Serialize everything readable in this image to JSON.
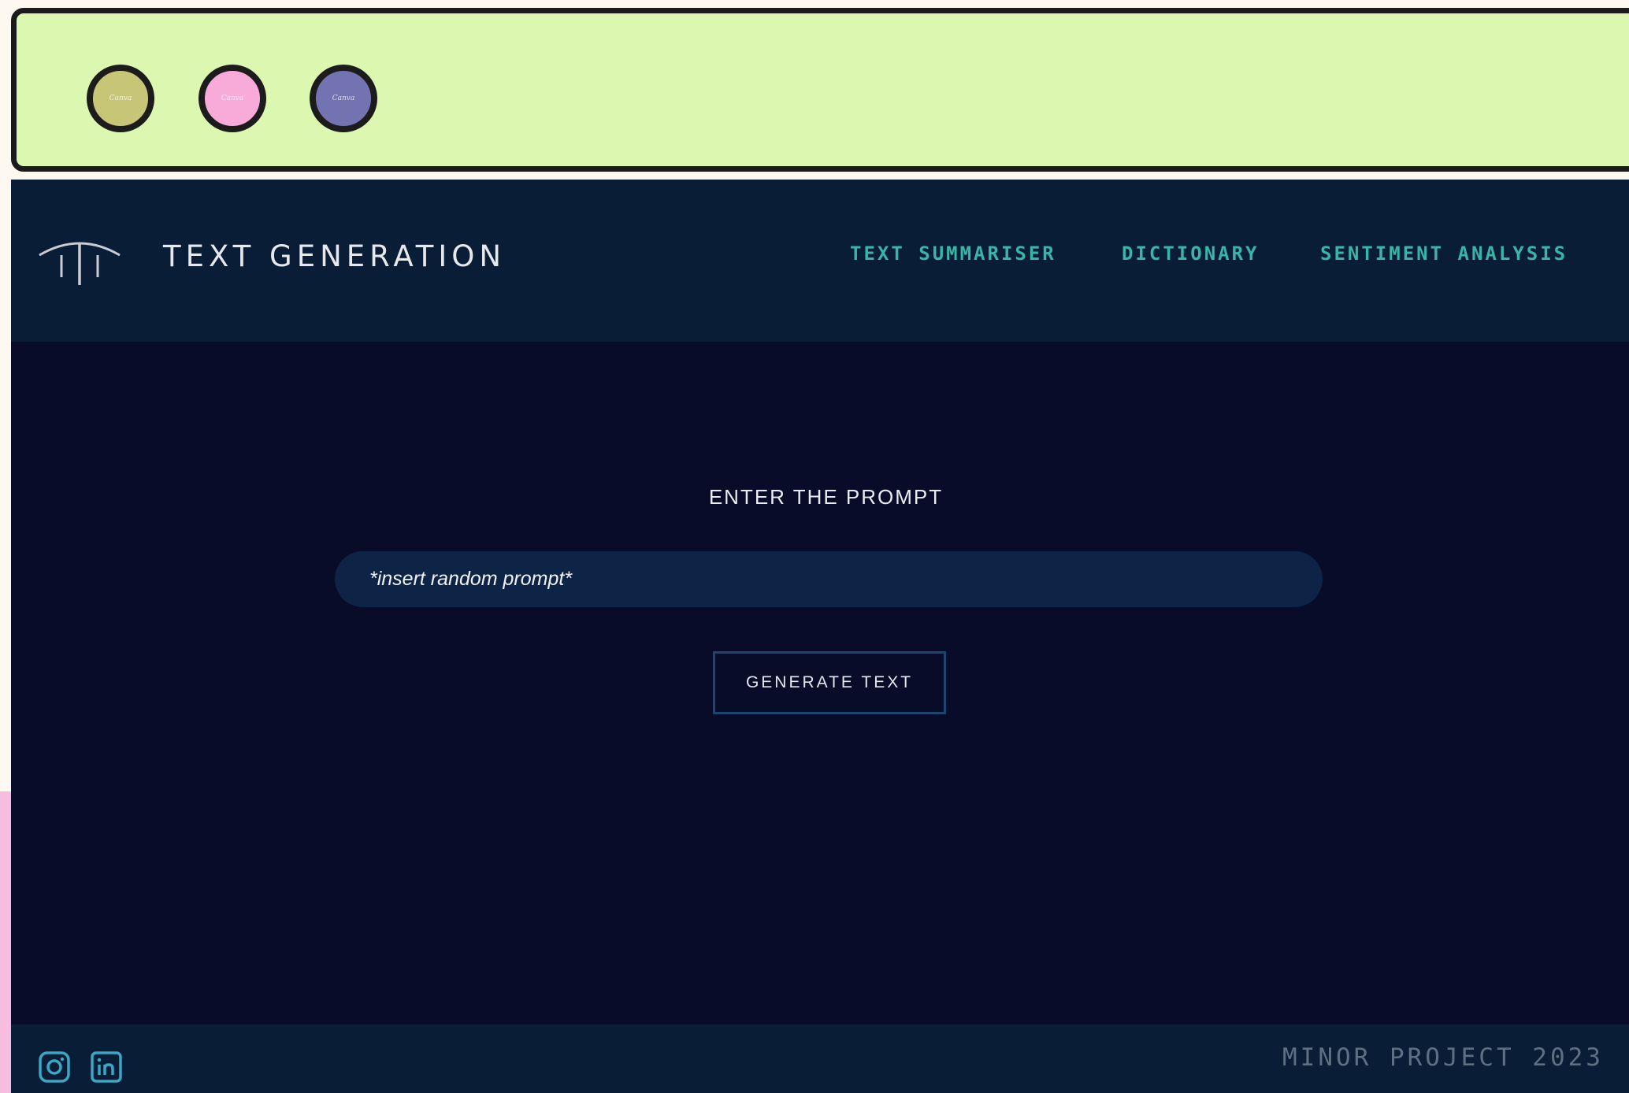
{
  "window": {
    "controls": [
      {
        "name": "dot-olive",
        "color": "#c7c677",
        "label": "Canva"
      },
      {
        "name": "dot-pink",
        "color": "#f8abd9",
        "label": "Canva"
      },
      {
        "name": "dot-purple",
        "color": "#7373b2",
        "label": "Canva"
      }
    ],
    "title_bar_color": "#dcf8b0"
  },
  "header": {
    "logo_icon": "pillars-logo-icon",
    "title": "TEXT GENERATION",
    "nav": [
      {
        "label": "TEXT SUMMARISER"
      },
      {
        "label": "DICTIONARY"
      },
      {
        "label": "SENTIMENT ANALYSIS"
      }
    ],
    "nav_color": "#39b5a7"
  },
  "main": {
    "prompt_label": "ENTER THE PROMPT",
    "prompt_input": {
      "value": "",
      "placeholder": "*insert random prompt*"
    },
    "generate_button": "GENERATE TEXT"
  },
  "footer": {
    "icons": [
      "instagram-icon",
      "linkedin-icon"
    ],
    "text": "MINOR PROJECT 2023"
  },
  "colors": {
    "app_background": "#080c28",
    "header_background": "#0a1d36",
    "input_background": "#0e2446"
  }
}
